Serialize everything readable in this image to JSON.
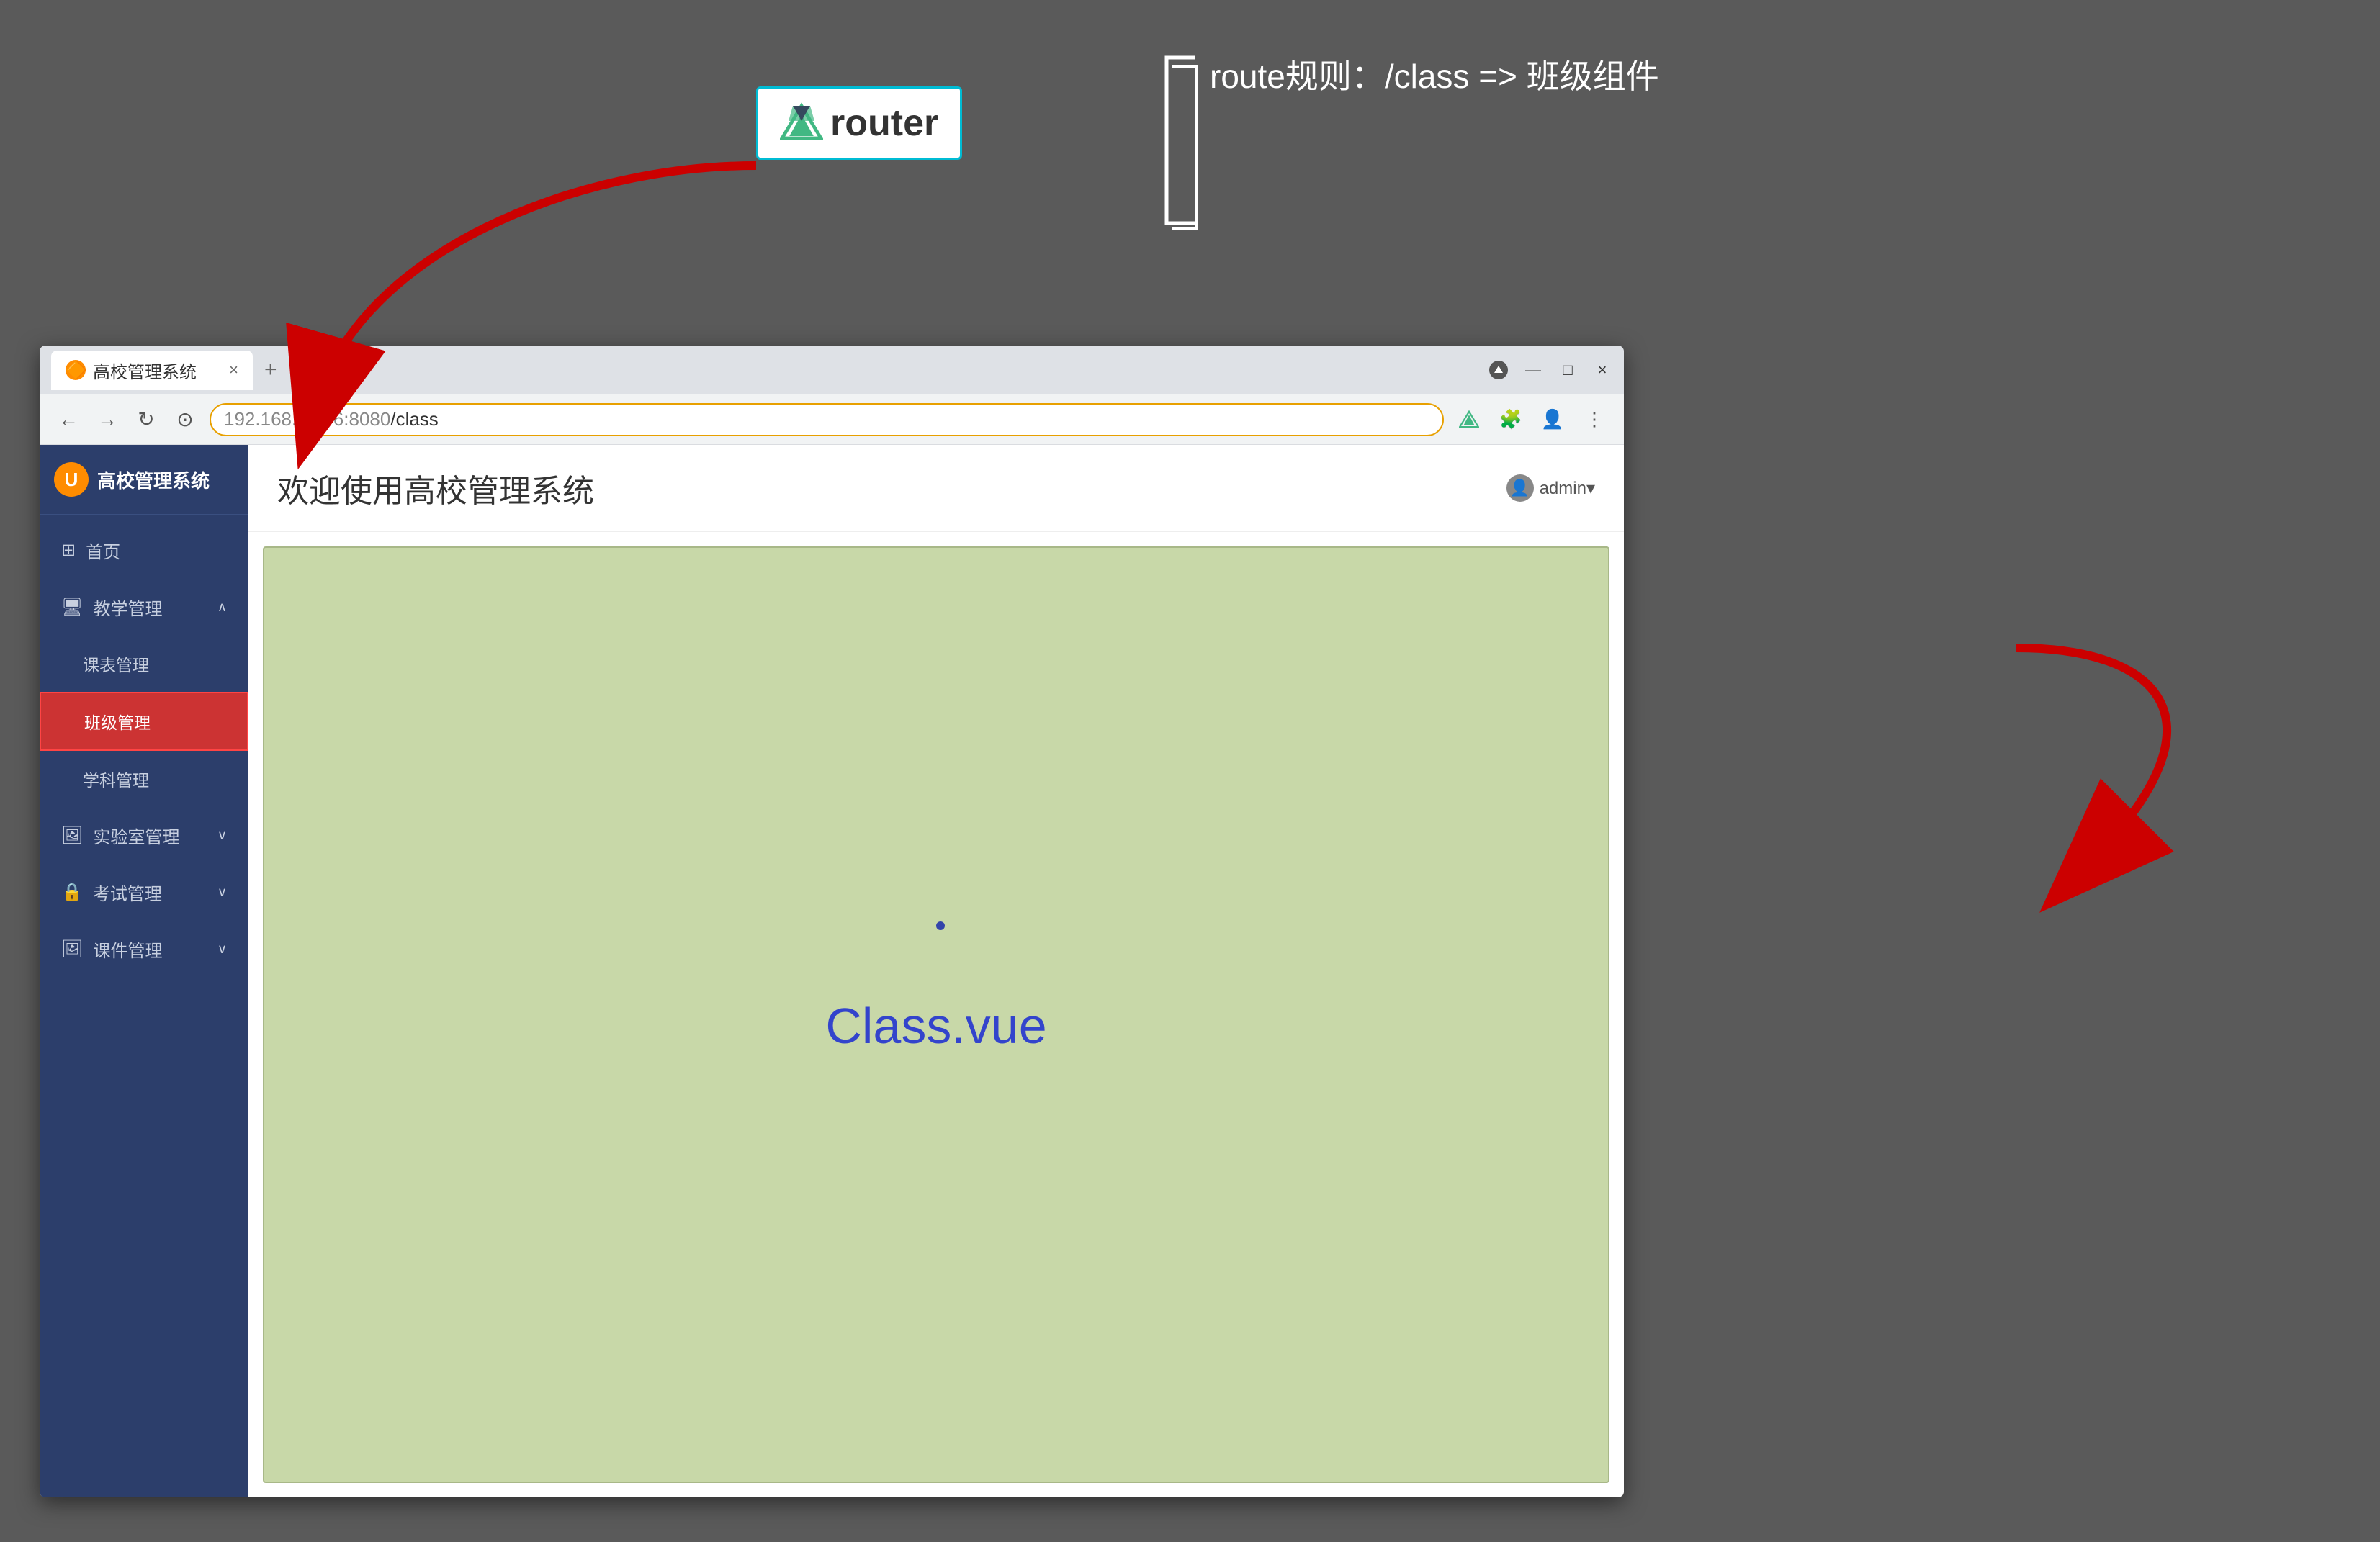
{
  "background": "#5a5a5a",
  "annotation": {
    "router_label": "router",
    "route_rule": "route规则：/class =>  班级组件"
  },
  "browser": {
    "tab_title": "高校管理系统",
    "tab_close": "×",
    "tab_new": "+",
    "address": "192.168.4.176:8080",
    "path": "/class",
    "win_minimize": "—",
    "win_maximize": "□",
    "win_close": "×"
  },
  "app": {
    "title": "欢迎使用高校管理系统",
    "admin_label": "admin▾",
    "logo_text": "高校管理系统",
    "sidebar": [
      {
        "label": "首页",
        "icon": "⊞",
        "level": 0,
        "active": false
      },
      {
        "label": "教学管理",
        "icon": "🖥",
        "level": 0,
        "active": false,
        "arrow": "∧"
      },
      {
        "label": "课表管理",
        "icon": "",
        "level": 1,
        "active": false
      },
      {
        "label": "班级管理",
        "icon": "",
        "level": 1,
        "active": true
      },
      {
        "label": "学科管理",
        "icon": "",
        "level": 1,
        "active": false
      },
      {
        "label": "实验室管理",
        "icon": "🖼",
        "level": 0,
        "active": false,
        "arrow": "∨"
      },
      {
        "label": "考试管理",
        "icon": "🔒",
        "level": 0,
        "active": false,
        "arrow": "∨"
      },
      {
        "label": "课件管理",
        "icon": "🖼",
        "level": 0,
        "active": false,
        "arrow": "∨"
      }
    ],
    "class_component": "Class.vue"
  }
}
